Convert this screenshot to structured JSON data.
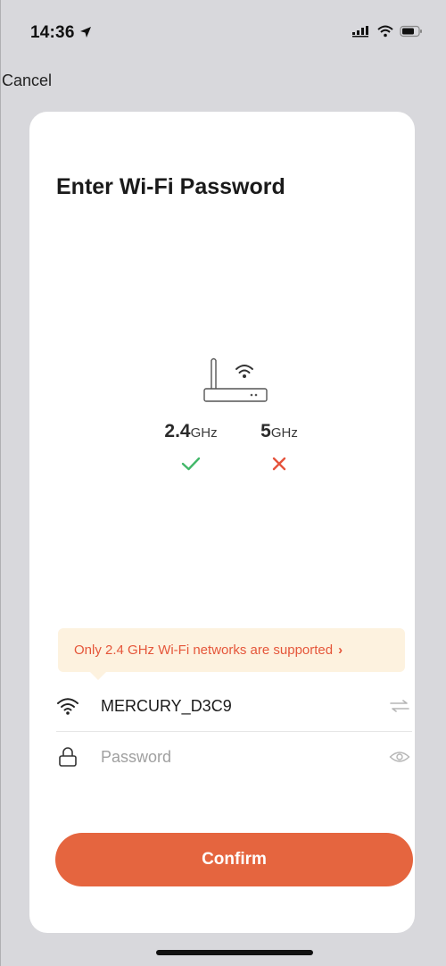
{
  "status_bar": {
    "time": "14:36",
    "location_icon": "location-arrow-icon",
    "signal_icon": "cellular-signal-icon",
    "wifi_icon": "wifi-status-icon",
    "battery_icon": "battery-icon"
  },
  "nav": {
    "cancel_label": "Cancel"
  },
  "sheet": {
    "title": "Enter Wi-Fi Password",
    "router_icon": "router-icon",
    "bands": [
      {
        "value": "2.4",
        "unit": "GHz",
        "supported": true,
        "mark_icon": "check-icon",
        "mark_color": "#43b86a"
      },
      {
        "value": "5",
        "unit": "GHz",
        "supported": false,
        "mark_icon": "cross-icon",
        "mark_color": "#e5533c"
      }
    ],
    "tooltip": {
      "text": "Only 2.4 GHz Wi-Fi networks are supported",
      "chevron": "›"
    },
    "ssid": {
      "icon": "wifi-icon",
      "value": "MERCURY_D3C9",
      "switch_icon": "switch-network-icon"
    },
    "password": {
      "icon": "lock-icon",
      "placeholder": "Password",
      "value": "",
      "toggle_icon": "eye-icon"
    },
    "confirm_label": "Confirm"
  },
  "colors": {
    "accent": "#e5653f",
    "tooltip_bg": "#fdf2df",
    "tooltip_text": "#e5563a",
    "check": "#43b86a",
    "cross": "#e5533c",
    "background": "#d8d8dc"
  }
}
